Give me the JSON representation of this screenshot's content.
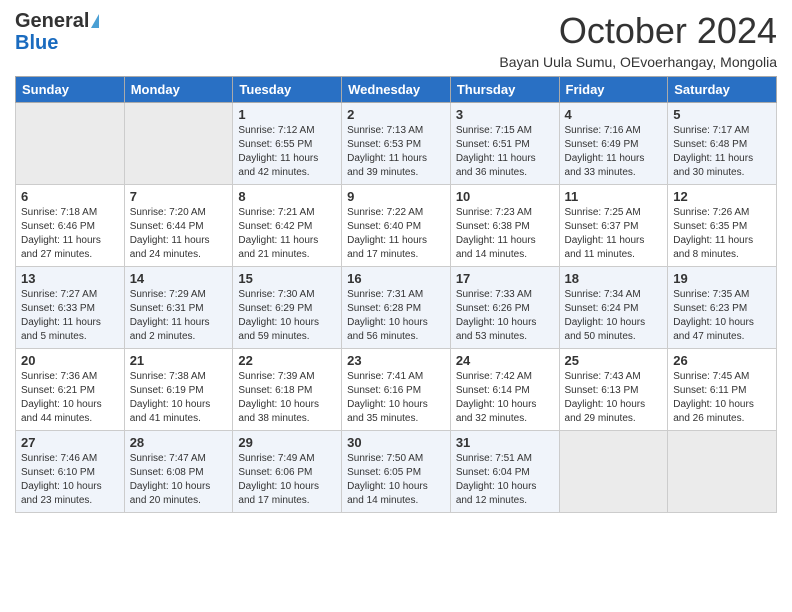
{
  "header": {
    "logo_general": "General",
    "logo_blue": "Blue",
    "month_title": "October 2024",
    "subtitle": "Bayan Uula Sumu, OEvoerhangay, Mongolia"
  },
  "days_of_week": [
    "Sunday",
    "Monday",
    "Tuesday",
    "Wednesday",
    "Thursday",
    "Friday",
    "Saturday"
  ],
  "weeks": [
    [
      {
        "day": "",
        "empty": true
      },
      {
        "day": "",
        "empty": true
      },
      {
        "day": "1",
        "sunrise": "7:12 AM",
        "sunset": "6:55 PM",
        "daylight": "11 hours and 42 minutes."
      },
      {
        "day": "2",
        "sunrise": "7:13 AM",
        "sunset": "6:53 PM",
        "daylight": "11 hours and 39 minutes."
      },
      {
        "day": "3",
        "sunrise": "7:15 AM",
        "sunset": "6:51 PM",
        "daylight": "11 hours and 36 minutes."
      },
      {
        "day": "4",
        "sunrise": "7:16 AM",
        "sunset": "6:49 PM",
        "daylight": "11 hours and 33 minutes."
      },
      {
        "day": "5",
        "sunrise": "7:17 AM",
        "sunset": "6:48 PM",
        "daylight": "11 hours and 30 minutes."
      }
    ],
    [
      {
        "day": "6",
        "sunrise": "7:18 AM",
        "sunset": "6:46 PM",
        "daylight": "11 hours and 27 minutes."
      },
      {
        "day": "7",
        "sunrise": "7:20 AM",
        "sunset": "6:44 PM",
        "daylight": "11 hours and 24 minutes."
      },
      {
        "day": "8",
        "sunrise": "7:21 AM",
        "sunset": "6:42 PM",
        "daylight": "11 hours and 21 minutes."
      },
      {
        "day": "9",
        "sunrise": "7:22 AM",
        "sunset": "6:40 PM",
        "daylight": "11 hours and 17 minutes."
      },
      {
        "day": "10",
        "sunrise": "7:23 AM",
        "sunset": "6:38 PM",
        "daylight": "11 hours and 14 minutes."
      },
      {
        "day": "11",
        "sunrise": "7:25 AM",
        "sunset": "6:37 PM",
        "daylight": "11 hours and 11 minutes."
      },
      {
        "day": "12",
        "sunrise": "7:26 AM",
        "sunset": "6:35 PM",
        "daylight": "11 hours and 8 minutes."
      }
    ],
    [
      {
        "day": "13",
        "sunrise": "7:27 AM",
        "sunset": "6:33 PM",
        "daylight": "11 hours and 5 minutes."
      },
      {
        "day": "14",
        "sunrise": "7:29 AM",
        "sunset": "6:31 PM",
        "daylight": "11 hours and 2 minutes."
      },
      {
        "day": "15",
        "sunrise": "7:30 AM",
        "sunset": "6:29 PM",
        "daylight": "10 hours and 59 minutes."
      },
      {
        "day": "16",
        "sunrise": "7:31 AM",
        "sunset": "6:28 PM",
        "daylight": "10 hours and 56 minutes."
      },
      {
        "day": "17",
        "sunrise": "7:33 AM",
        "sunset": "6:26 PM",
        "daylight": "10 hours and 53 minutes."
      },
      {
        "day": "18",
        "sunrise": "7:34 AM",
        "sunset": "6:24 PM",
        "daylight": "10 hours and 50 minutes."
      },
      {
        "day": "19",
        "sunrise": "7:35 AM",
        "sunset": "6:23 PM",
        "daylight": "10 hours and 47 minutes."
      }
    ],
    [
      {
        "day": "20",
        "sunrise": "7:36 AM",
        "sunset": "6:21 PM",
        "daylight": "10 hours and 44 minutes."
      },
      {
        "day": "21",
        "sunrise": "7:38 AM",
        "sunset": "6:19 PM",
        "daylight": "10 hours and 41 minutes."
      },
      {
        "day": "22",
        "sunrise": "7:39 AM",
        "sunset": "6:18 PM",
        "daylight": "10 hours and 38 minutes."
      },
      {
        "day": "23",
        "sunrise": "7:41 AM",
        "sunset": "6:16 PM",
        "daylight": "10 hours and 35 minutes."
      },
      {
        "day": "24",
        "sunrise": "7:42 AM",
        "sunset": "6:14 PM",
        "daylight": "10 hours and 32 minutes."
      },
      {
        "day": "25",
        "sunrise": "7:43 AM",
        "sunset": "6:13 PM",
        "daylight": "10 hours and 29 minutes."
      },
      {
        "day": "26",
        "sunrise": "7:45 AM",
        "sunset": "6:11 PM",
        "daylight": "10 hours and 26 minutes."
      }
    ],
    [
      {
        "day": "27",
        "sunrise": "7:46 AM",
        "sunset": "6:10 PM",
        "daylight": "10 hours and 23 minutes."
      },
      {
        "day": "28",
        "sunrise": "7:47 AM",
        "sunset": "6:08 PM",
        "daylight": "10 hours and 20 minutes."
      },
      {
        "day": "29",
        "sunrise": "7:49 AM",
        "sunset": "6:06 PM",
        "daylight": "10 hours and 17 minutes."
      },
      {
        "day": "30",
        "sunrise": "7:50 AM",
        "sunset": "6:05 PM",
        "daylight": "10 hours and 14 minutes."
      },
      {
        "day": "31",
        "sunrise": "7:51 AM",
        "sunset": "6:04 PM",
        "daylight": "10 hours and 12 minutes."
      },
      {
        "day": "",
        "empty": true
      },
      {
        "day": "",
        "empty": true
      }
    ]
  ]
}
